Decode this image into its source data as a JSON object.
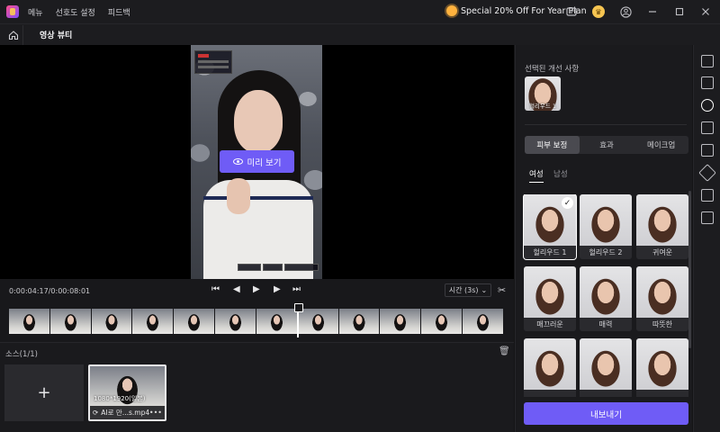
{
  "titlebar": {
    "menu": [
      "메뉴",
      "선호도 설정",
      "피드백"
    ],
    "promo": "Special 20% Off For Year Plan",
    "controls": [
      "minimize-icon",
      "maximize-icon",
      "close-icon"
    ]
  },
  "subbar": {
    "title": "영상 뷰티"
  },
  "preview": {
    "button_label": "미리 보기"
  },
  "playback": {
    "timecode": "0:00:04:17/0:00:08:01",
    "speed": "시간 (3s)"
  },
  "sources": {
    "title": "소스(1/1)",
    "add": "+",
    "clip": {
      "resolution": "1080*1920(일본)",
      "name": "AI로 만...s.mp4",
      "more": "•••"
    }
  },
  "panel": {
    "selected_title": "선택된 개선 사항",
    "selected_item": "헐리우드 1",
    "tabs": [
      "피부 보정",
      "효과",
      "메이크업"
    ],
    "active_tab": 0,
    "genders": [
      "여성",
      "남성"
    ],
    "presets": [
      "헐리우드 1",
      "헐리우드 2",
      "귀여운",
      "매끄러운",
      "매력",
      "따뜻한",
      "",
      "",
      ""
    ],
    "selected_preset": 0,
    "export_label": "내보내기"
  },
  "colors": {
    "accent": "#6f5cf6",
    "background": "#141416",
    "panel": "#1a1a1d"
  }
}
